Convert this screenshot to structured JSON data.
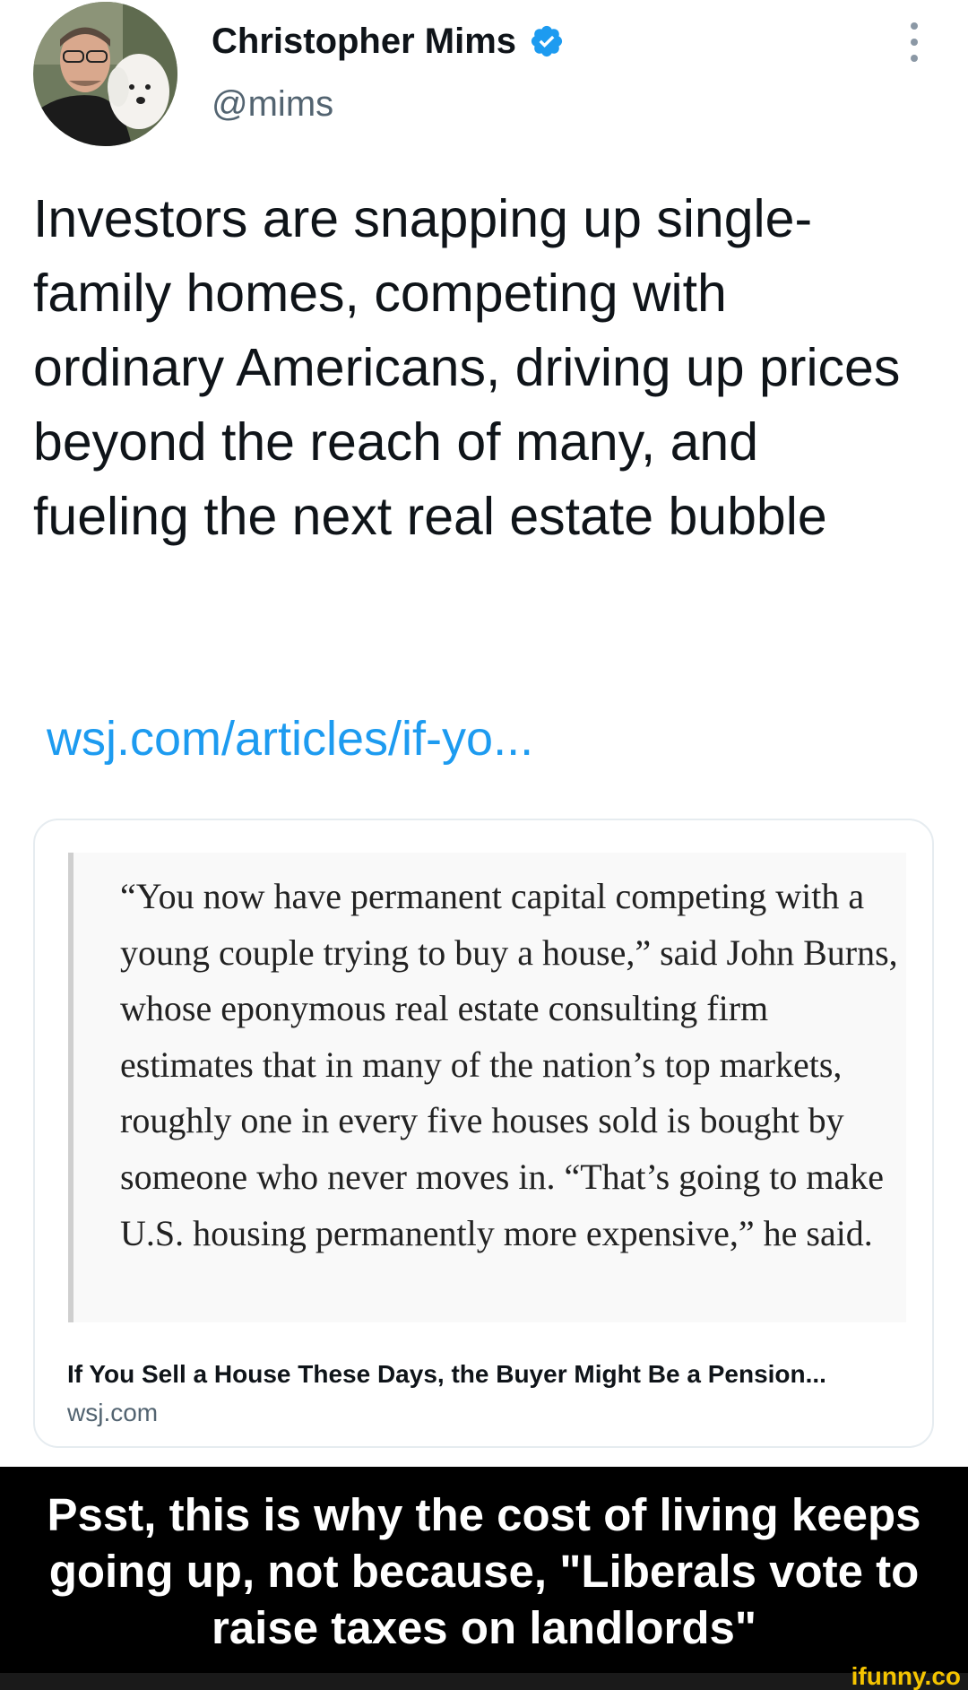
{
  "author": {
    "name": "Christopher Mims",
    "handle": "@mims"
  },
  "tweet": {
    "text": "Investors are snapping up single-family homes, competing with ordinary Americans, driving up prices beyond the reach of many, and fueling the next real estate bubble",
    "link": "wsj.com/articles/if-yo..."
  },
  "card": {
    "quote": "“You now have permanent capital competing with a young couple trying to buy a house,” said John Burns, whose eponymous real estate consulting firm estimates that in many of the nation’s top markets, roughly one in every five houses sold is bought by someone who never moves in. “That’s going to make U.S. housing permanently more expensive,” he said.",
    "title": "If You Sell a House These Days, the Buyer Might Be a Pension...",
    "domain": "wsj.com"
  },
  "caption": "Psst, this is why the cost of living keeps going up, not because, \"Liberals vote to raise taxes on landlords\"",
  "watermark": "ifunny.co",
  "colors": {
    "link": "#1d9bf0",
    "verified": "#1d9bf0",
    "caption_bg": "#000000",
    "watermark": "#f5c400"
  },
  "icons": [
    "verified-badge-icon",
    "more-options-icon"
  ]
}
